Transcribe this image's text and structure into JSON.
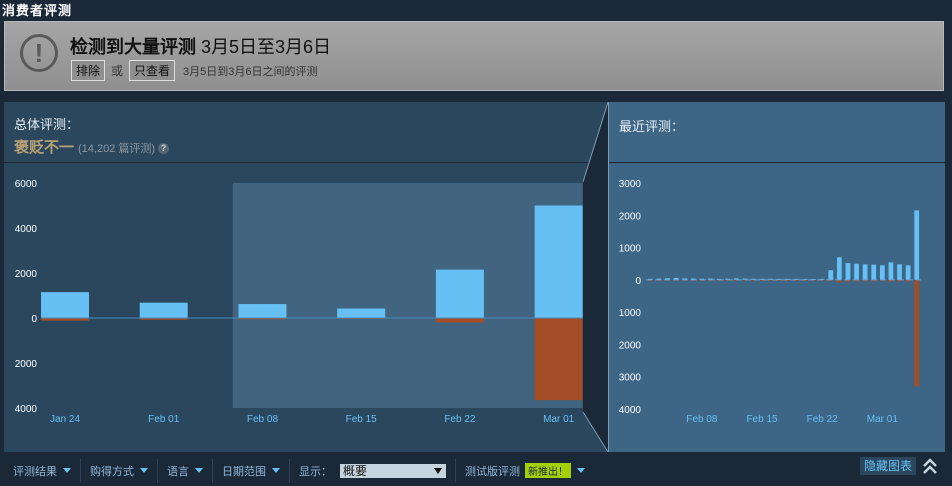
{
  "section_title": "消费者评测",
  "alert": {
    "icon": "warning-icon",
    "title_bold": "检测到大量评测",
    "title_range": " 3月5日至3月6日",
    "exclude_label": "排除",
    "or_label": "或",
    "only_label": "只查看",
    "description": "3月5日到3月6日之间的评测"
  },
  "overall": {
    "label": "总体评测：",
    "summary": "褒贬不一",
    "count": "(14,202 篇评测)",
    "help": "?"
  },
  "recent": {
    "label": "最近评测："
  },
  "filters": {
    "items": [
      "评测结果",
      "购得方式",
      "语言",
      "日期范围"
    ],
    "display_label": "显示：",
    "display_value": "概要",
    "beta_label": "测试版评测",
    "beta_badge": "新推出！"
  },
  "hide_chart": "隐藏图表",
  "chart_data": [
    {
      "type": "bar",
      "categories": [
        "Jan 24",
        "Feb 01",
        "Feb 08",
        "Feb 15",
        "Feb 22",
        "Mar 01"
      ],
      "series": [
        {
          "values": [
            1150,
            680,
            620,
            420,
            2150,
            5000
          ]
        },
        {
          "values": [
            -120,
            -80,
            -60,
            -40,
            -200,
            -3650
          ]
        }
      ],
      "ylim": [
        -4000,
        6000
      ],
      "yticks": [
        "6000",
        "4000",
        "2000",
        "0",
        "2000",
        "4000"
      ],
      "yvals": [
        6000,
        4000,
        2000,
        0,
        -2000,
        -4000
      ],
      "highlight": [
        1.7,
        5.0
      ],
      "colors": {
        "positive": "#66c0f4",
        "negative": "#a34c25",
        "highlight": "#416580"
      }
    },
    {
      "type": "bar",
      "categories": [
        "Feb 08",
        "Feb 15",
        "Feb 22",
        "Mar 01"
      ],
      "category_index": [
        6,
        13,
        20,
        27
      ],
      "series": [
        {
          "values": [
            30,
            40,
            50,
            60,
            45,
            40,
            35,
            40,
            30,
            35,
            45,
            40,
            35,
            30,
            35,
            30,
            30,
            30,
            25,
            25,
            30,
            300,
            700,
            520,
            500,
            480,
            470,
            450,
            540,
            480,
            450,
            2150
          ]
        },
        {
          "values": [
            -5,
            -5,
            -5,
            -5,
            -5,
            -5,
            -5,
            -5,
            -5,
            -5,
            -5,
            -5,
            -5,
            -5,
            -5,
            -5,
            -5,
            -5,
            -5,
            -5,
            -5,
            -40,
            -80,
            -60,
            -50,
            -50,
            -50,
            -40,
            -60,
            -50,
            -50,
            -3300
          ]
        }
      ],
      "ylim": [
        -4000,
        3000
      ],
      "yticks": [
        "3000",
        "2000",
        "1000",
        "0",
        "1000",
        "2000",
        "3000",
        "4000"
      ],
      "yvals": [
        3000,
        2000,
        1000,
        0,
        -1000,
        -2000,
        -3000,
        -4000
      ],
      "colors": {
        "positive": "#66c0f4",
        "negative": "#a34c25",
        "zero": "#66c0f4"
      }
    }
  ]
}
